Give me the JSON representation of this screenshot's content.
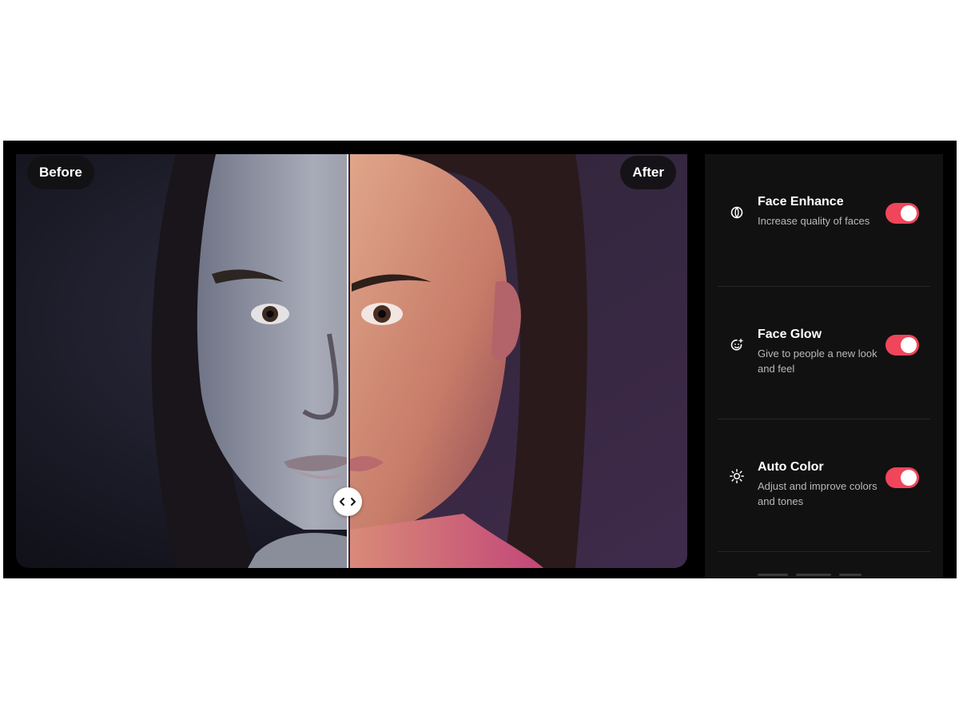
{
  "comparison": {
    "before_label": "Before",
    "after_label": "After",
    "split_percent": 49.4
  },
  "settings": [
    {
      "title": "Face Enhance",
      "description": "Increase quality of faces",
      "enabled": true,
      "icon": "face-enhance-icon"
    },
    {
      "title": "Face Glow",
      "description": "Give to people a new look and feel",
      "enabled": true,
      "icon": "face-glow-icon"
    },
    {
      "title": "Auto Color",
      "description": "Adjust and improve colors and tones",
      "enabled": true,
      "icon": "sun-icon"
    }
  ],
  "colors": {
    "accent": "#f0455a",
    "background": "#000000",
    "panel": "#111112"
  }
}
